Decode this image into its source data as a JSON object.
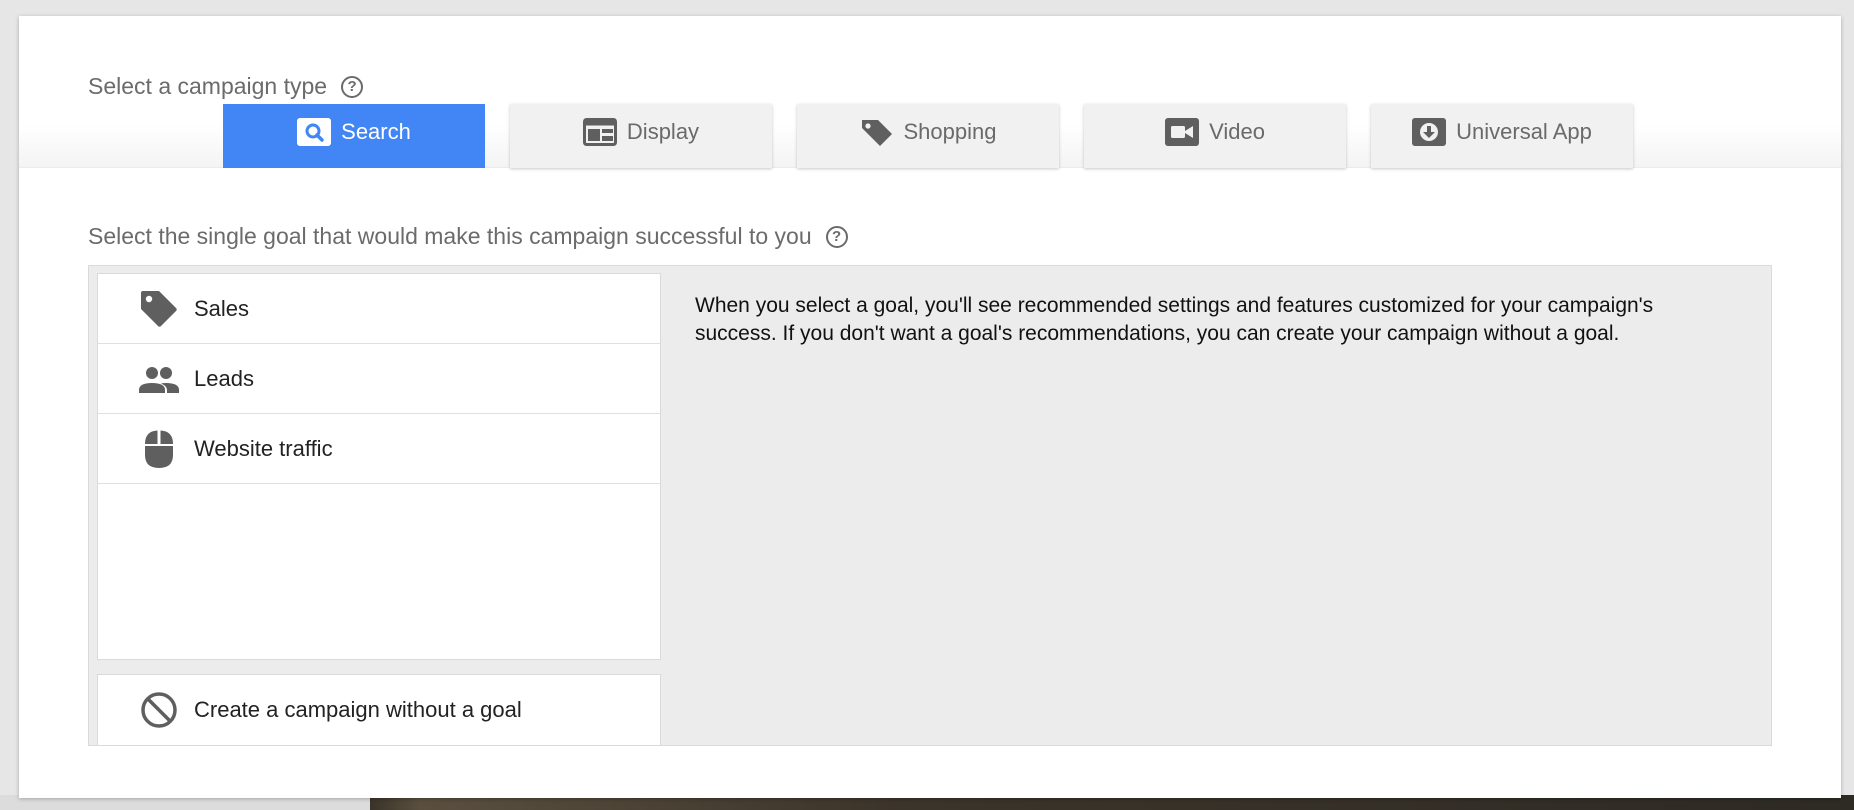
{
  "campaign_type": {
    "label": "Select a campaign type",
    "help_icon": "?",
    "tabs": [
      {
        "label": "Search",
        "icon": "search-icon",
        "active": true
      },
      {
        "label": "Display",
        "icon": "display-icon",
        "active": false
      },
      {
        "label": "Shopping",
        "icon": "tag-icon",
        "active": false
      },
      {
        "label": "Video",
        "icon": "video-icon",
        "active": false
      },
      {
        "label": "Universal App",
        "icon": "download-icon",
        "active": false
      }
    ]
  },
  "goal": {
    "label": "Select the single goal that would make this campaign successful to you",
    "help_icon": "?",
    "items": [
      {
        "label": "Sales",
        "icon": "tag-icon"
      },
      {
        "label": "Leads",
        "icon": "people-icon"
      },
      {
        "label": "Website traffic",
        "icon": "mouse-icon"
      }
    ],
    "no_goal": {
      "label": "Create a campaign without a goal",
      "icon": "block-icon"
    },
    "description": "When you select a goal, you'll see recommended settings and features customized for your campaign's success. If you don't want a goal's recommendations, you can create your campaign without a goal."
  },
  "colors": {
    "accent": "#4285f4",
    "tab_bg": "#f1f1f1",
    "panel_bg": "#ececec",
    "icon": "#5f5f5f"
  }
}
